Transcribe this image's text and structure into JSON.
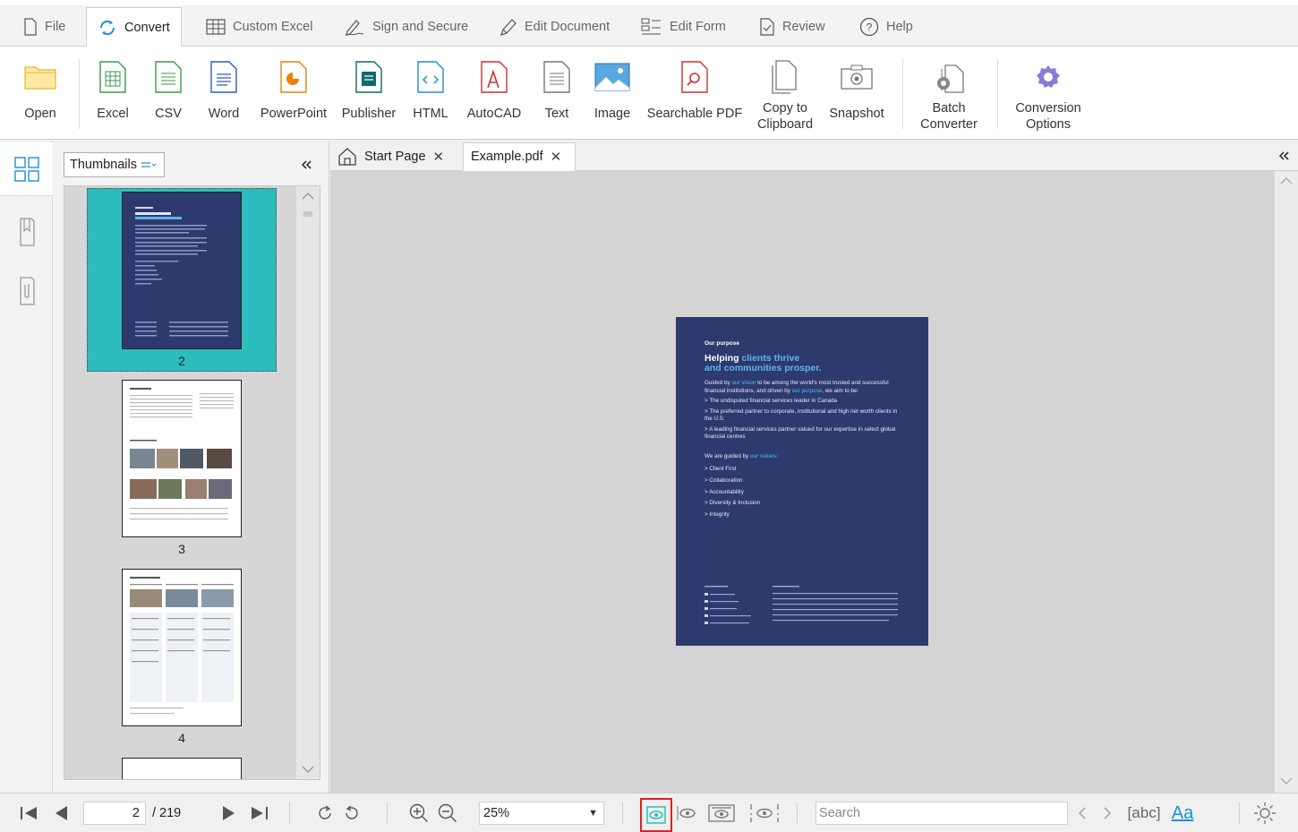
{
  "menu": {
    "file": "File",
    "convert": "Convert",
    "custom_excel": "Custom Excel",
    "sign_secure": "Sign and Secure",
    "edit_document": "Edit Document",
    "edit_form": "Edit Form",
    "review": "Review",
    "help": "Help"
  },
  "ribbon": {
    "open": "Open",
    "excel": "Excel",
    "csv": "CSV",
    "word": "Word",
    "powerpoint": "PowerPoint",
    "publisher": "Publisher",
    "html": "HTML",
    "autocad": "AutoCAD",
    "text": "Text",
    "image": "Image",
    "searchable_pdf": "Searchable PDF",
    "copy_line1": "Copy to",
    "copy_line2": "Clipboard",
    "snapshot": "Snapshot",
    "batch_line1": "Batch",
    "batch_line2": "Converter",
    "conv_line1": "Conversion",
    "conv_line2": "Options"
  },
  "panel": {
    "view_select": "Thumbnails",
    "thumbs": [
      {
        "num": "2"
      },
      {
        "num": "3"
      },
      {
        "num": "4"
      }
    ]
  },
  "tabs": {
    "start_page": "Start Page",
    "example": "Example.pdf"
  },
  "document": {
    "heading_small": "Our purpose",
    "title_a": "Helping ",
    "title_b": "clients thrive",
    "title_c": "and communities prosper.",
    "para_a": "Guided by ",
    "para_b": "our vision",
    "para_c": " to be among the world's most trusted and successful financial institutions, and driven by ",
    "para_d": "our purpose",
    "para_e": ", we aim to be:",
    "bullets": [
      "> The undisputed financial services leader in Canada",
      "> The preferred partner to corporate, institutional and high net worth clients in the U.S.",
      "> A leading financial services partner valued for our expertise in select global financial centres"
    ],
    "values_a": "We are guided by ",
    "values_b": "our values",
    "values_c": ":",
    "values": [
      "> Client First",
      "> Collaboration",
      "> Accountability",
      "> Diversity & Inclusion",
      "> Integrity"
    ]
  },
  "status": {
    "page_current": "2",
    "page_total": "/ 219",
    "zoom": "25%",
    "search_placeholder": "Search",
    "find_whole_word": "abc",
    "match_case": "Aa"
  },
  "colors": {
    "accent": "#2dbdbc",
    "page_blue": "#2d3a6e",
    "highlight_blue": "#5bb8e8",
    "icon_blue": "#1f8fd1",
    "icon_green": "#3a9a4a",
    "icon_orange": "#e8820c",
    "icon_red": "#d03030",
    "active_outline": "#e02020"
  }
}
